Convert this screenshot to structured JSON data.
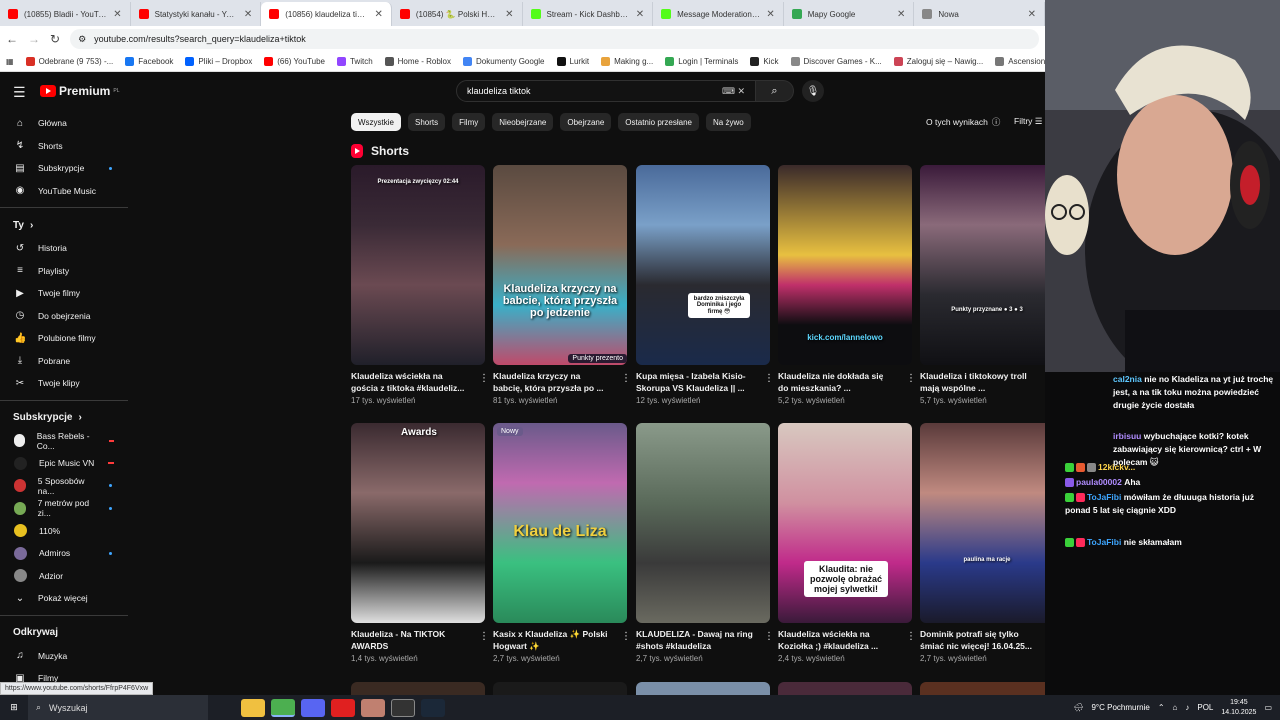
{
  "browser": {
    "tabs": [
      {
        "title": "(10855) Bladii - YouTube",
        "color": "#ff0000"
      },
      {
        "title": "Statystyki kanału - YouTube S",
        "color": "#ff0000"
      },
      {
        "title": "(10856) klaudeliza tiktok - Yo",
        "color": "#ff0000",
        "active": true
      },
      {
        "title": "(10854) 🐍 Polski Hogwart 🐍",
        "color": "#ff0000"
      },
      {
        "title": "Stream - Kick Dashboard",
        "color": "#53fc18"
      },
      {
        "title": "Message Moderation - Kick",
        "color": "#53fc18"
      },
      {
        "title": "Mapy Google",
        "color": "#34a853"
      },
      {
        "title": "Nowa",
        "color": "#888888"
      }
    ],
    "url": "youtube.com/results?search_query=klaudeliza+tiktok",
    "bookmarks": [
      "Odebrane (9 753) -...",
      "Facebook",
      "Pliki – Dropbox",
      "(66) YouTube",
      "Twitch",
      "Home - Roblox",
      "Dokumenty Google",
      "Lurkit",
      "Making g...",
      "Login | Terminals",
      "Kick",
      "Discover Games - K...",
      "Zaloguj się – Nawig...",
      "Ascensions Guide v...",
      "https://v"
    ]
  },
  "youtube": {
    "logo_text": "Premium",
    "logo_sup": "PL",
    "search_value": "klaudeliza tiktok",
    "sidebar": {
      "main": [
        "Główna",
        "Shorts",
        "Subskrypcje",
        "YouTube Music"
      ],
      "you_header": "Ty",
      "you": [
        "Historia",
        "Playlisty",
        "Twoje filmy",
        "Do obejrzenia",
        "Polubione filmy",
        "Pobrane",
        "Twoje klipy"
      ],
      "subs_header": "Subskrypcje",
      "subs": [
        "Bass Rebels - Co...",
        "Epic Music VN",
        "5 Sposobów na...",
        "7 metrów pod zi...",
        "110%",
        "Admiros",
        "Adzior"
      ],
      "show_more": "Pokaż więcej",
      "explore_header": "Odkrywaj",
      "explore": [
        "Muzyka",
        "Filmy"
      ]
    },
    "chips": [
      "Wszystkie",
      "Shorts",
      "Filmy",
      "Nieobejrzane",
      "Obejrzane",
      "Ostatnio przesłane",
      "Na żywo"
    ],
    "about_results": "O tych wynikach",
    "filters": "Filtry",
    "shorts_title": "Shorts",
    "row1": [
      {
        "title": "Klaudeliza wściekła na gościa z tiktoka #klaudeliz...",
        "views": "17 tys. wyświetleń",
        "overlay": "Prezentacja zwycięzcy 02:44"
      },
      {
        "title": "Klaudeliza krzyczy na babcię, która przyszła po ...",
        "views": "81 tys. wyświetleń",
        "overlay": "Klaudeliza krzyczy na babcie, która przyszła po jedzenie",
        "badge": "Punkty prezento"
      },
      {
        "title": "Kupa mięsa - Izabela Kisio-Skorupa VS Klaudeliza || ...",
        "views": "12 tys. wyświetleń",
        "overlay": "bardzo zniszczyła Dominika i jego firmę 😳"
      },
      {
        "title": "Klaudeliza nie dokłada się do mieszkania?  ...",
        "views": "5,2 tys. wyświetleń",
        "overlay": "kick.com/lannelowo"
      },
      {
        "title": "Klaudeliza i tiktokowy troll mają wspólne ...",
        "views": "5,7 tys. wyświetleń",
        "overlay": "Punkty przyznane ● 3 ● 3"
      }
    ],
    "row2": [
      {
        "title": "Klaudeliza - Na TIKTOK AWARDS",
        "views": "1,4 tys. wyświetleń",
        "overlay": "Awards"
      },
      {
        "title": "Kasix x Klaudeliza ✨ Polski Hogwart ✨",
        "views": "2,7 tys. wyświetleń",
        "overlay": "Klau de Liza",
        "badge": "Nowy"
      },
      {
        "title": "KLAUDELIZA - Dawaj na ring #shots #klaudeliza",
        "views": "2,7 tys. wyświetleń",
        "overlay": ""
      },
      {
        "title": "Klaudeliza wściekła na Koziołka ;) #klaudeliza ...",
        "views": "2,4 tys. wyświetleń",
        "overlay": "Klaudita: nie pozwolę obrażać mojej sylwetki!"
      },
      {
        "title": "Dominik potrafi się tylko śmiać nic więcej! 16.04.25...",
        "views": "2,7 tys. wyświetleń",
        "overlay": "paulina ma racje"
      }
    ],
    "status_url": "https://www.youtube.com/shorts/FfrpP4F6Vxw"
  },
  "chat": [
    {
      "name": "cal2nia",
      "color": "#5ec8ff",
      "text": "nie no Kladeliza na yt już trochę jest, a na tik toku można powiedzieć drugie życie dostała"
    },
    {
      "name": "irbisuu",
      "color": "#b08cff",
      "text": "wybuchające kotki? kotek zabawiający się kierownicą? ctrl + W polecam 😺"
    },
    {
      "name": "12kickv...",
      "color": "#ffd54a",
      "text": ""
    },
    {
      "name": "paula00002",
      "color": "#b08cff",
      "text": "Aha"
    },
    {
      "name": "ToJaFibi",
      "color": "#3ea6ff",
      "text": "mówiłam że dłuuuga historia już ponad 5 lat się ciągnie XDD"
    },
    {
      "name": "ToJaFibi",
      "color": "#3ea6ff",
      "text": "nie skłamałam"
    }
  ],
  "taskbar": {
    "search": "Wyszukaj",
    "weather": "9°C  Pochmurnie",
    "lang": "POL",
    "time": "19:45",
    "date": "14.10.2025"
  }
}
